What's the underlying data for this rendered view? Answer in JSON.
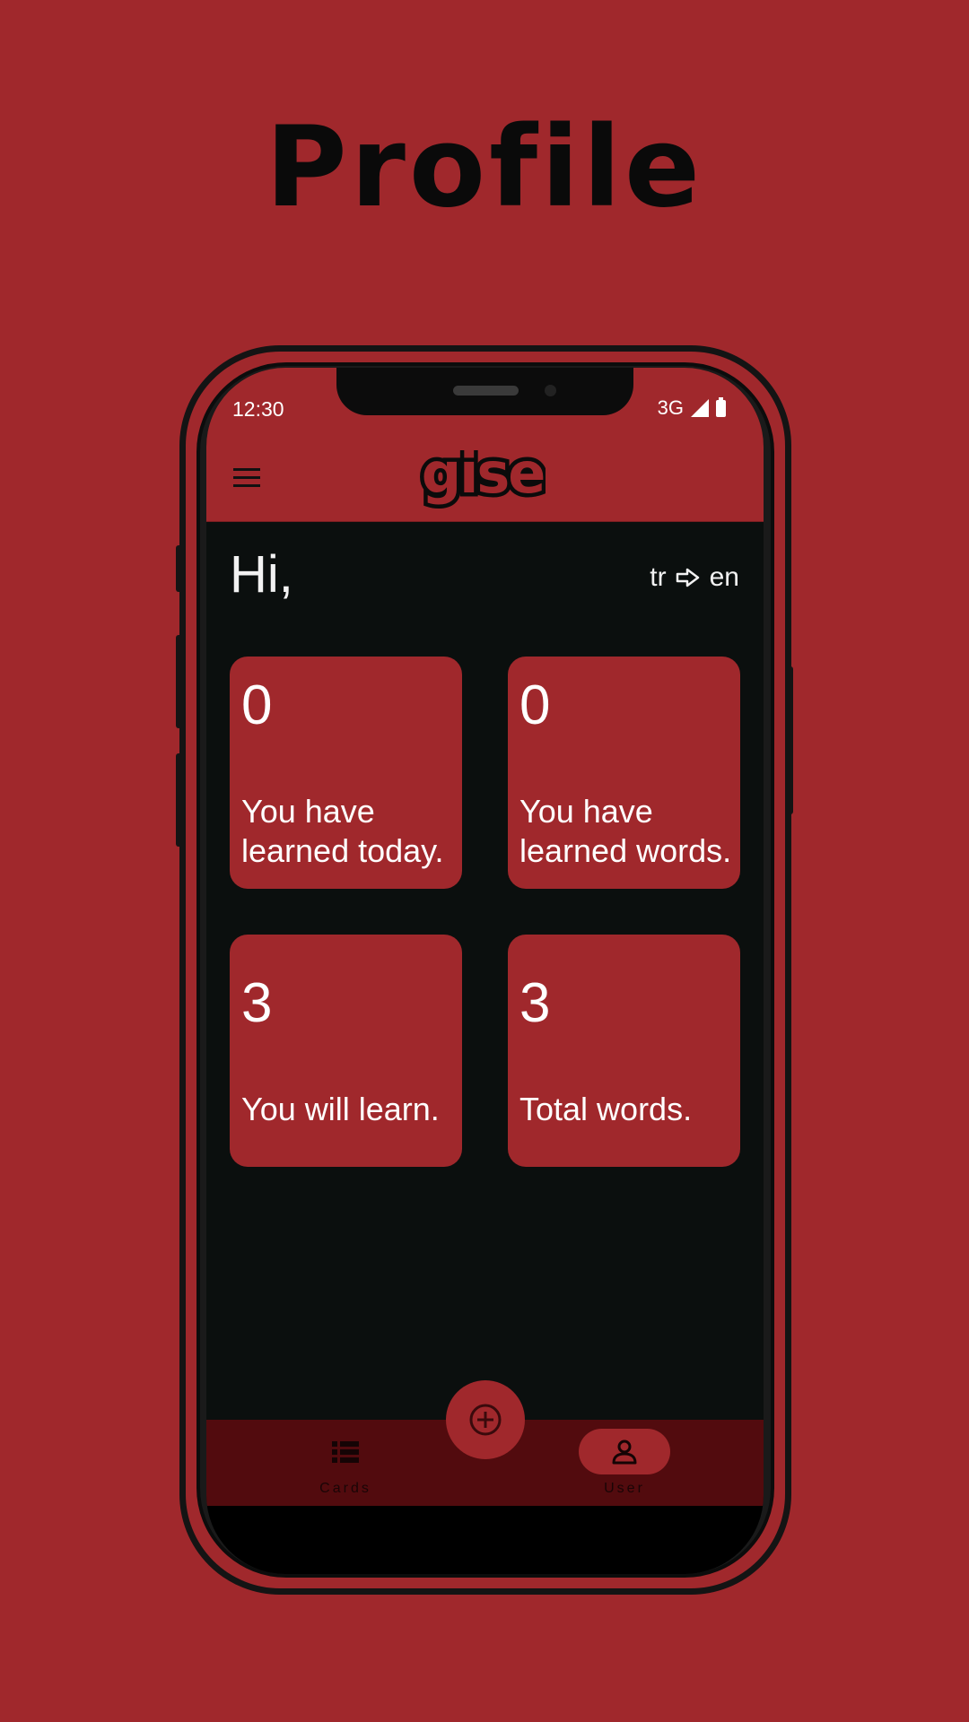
{
  "promo": {
    "title": "Profile"
  },
  "status_bar": {
    "time": "12:30",
    "network": "3G",
    "icons": [
      "signal-icon",
      "battery-icon"
    ]
  },
  "app_bar": {
    "logo_text": "gise",
    "menu_icon": "hamburger-menu-icon"
  },
  "greeting": "Hi,",
  "language_pair": {
    "from": "tr",
    "to": "en",
    "icon": "arrow-right-outline-icon"
  },
  "stats": [
    {
      "value": "0",
      "label": "You have learned today."
    },
    {
      "value": "0",
      "label": "You have learned words."
    },
    {
      "value": "3",
      "label": "You will learn."
    },
    {
      "value": "3",
      "label": "Total words."
    }
  ],
  "bottom_nav": {
    "items": [
      {
        "label": "Cards",
        "icon": "list-icon",
        "selected": false
      },
      {
        "label": "User",
        "icon": "person-icon",
        "selected": true
      }
    ],
    "fab_icon": "add-circle-icon"
  },
  "colors": {
    "background": "#a0282c",
    "screen_background": "#0b0f0e",
    "card": "#a0282c",
    "bottom_nav": "#520b0e",
    "text": "#ffffff"
  }
}
